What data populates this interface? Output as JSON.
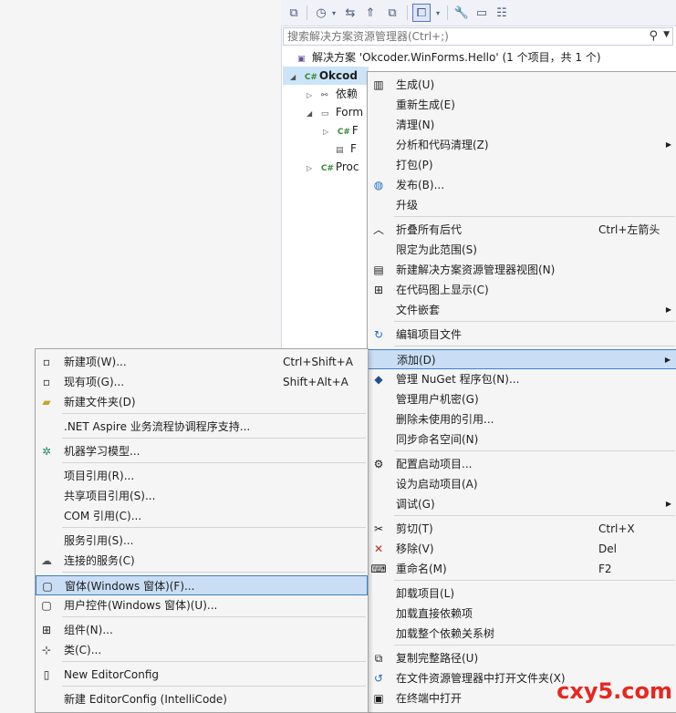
{
  "toolbar": {
    "icons": [
      "vs-icon",
      "history-icon",
      "dropdown-icon",
      "sync-icon",
      "collapse-icon",
      "copy-icon",
      "filter-icon",
      "dropdown-icon",
      "wrench-icon",
      "minus-icon",
      "class-view-icon"
    ]
  },
  "search": {
    "placeholder": "搜索解决方案资源管理器(Ctrl+;)"
  },
  "tree": {
    "solution": "解决方案 'Okcoder.WinForms.Hello' (1 个项目，共 1 个)",
    "project": "Okcod",
    "dependencies": "依赖",
    "forms": "Form",
    "form_file_1": "F",
    "form_file_2": "F",
    "program": "Proc"
  },
  "main_menu": [
    {
      "label": "生成(U)",
      "icon": "build-icon"
    },
    {
      "label": "重新生成(E)"
    },
    {
      "label": "清理(N)"
    },
    {
      "label": "分析和代码清理(Z)",
      "submenu": true
    },
    {
      "label": "打包(P)"
    },
    {
      "label": "发布(B)...",
      "icon": "globe-icon"
    },
    {
      "label": "升级"
    },
    {
      "label": "折叠所有后代",
      "shortcut": "Ctrl+左箭头",
      "icon": "chevron-up-icon"
    },
    {
      "label": "限定为此范围(S)"
    },
    {
      "label": "新建解决方案资源管理器视图(N)",
      "icon": "new-view-icon"
    },
    {
      "label": "在代码图上显示(C)",
      "icon": "code-map-icon"
    },
    {
      "label": "文件嵌套",
      "submenu": true
    },
    {
      "label": "编辑项目文件",
      "icon": "edit-icon"
    },
    {
      "label": "添加(D)",
      "submenu": true,
      "highlight": true
    },
    {
      "label": "管理 NuGet 程序包(N)...",
      "icon": "nuget-icon"
    },
    {
      "label": "管理用户机密(G)"
    },
    {
      "label": "删除未使用的引用..."
    },
    {
      "label": "同步命名空间(N)"
    },
    {
      "label": "配置启动项目...",
      "icon": "gear-icon"
    },
    {
      "label": "设为启动项目(A)"
    },
    {
      "label": "调试(G)",
      "submenu": true
    },
    {
      "label": "剪切(T)",
      "shortcut": "Ctrl+X",
      "icon": "scissors-icon"
    },
    {
      "label": "移除(V)",
      "shortcut": "Del",
      "icon": "remove-icon"
    },
    {
      "label": "重命名(M)",
      "shortcut": "F2",
      "icon": "rename-icon"
    },
    {
      "label": "卸载项目(L)"
    },
    {
      "label": "加载直接依赖项"
    },
    {
      "label": "加载整个依赖关系树"
    },
    {
      "label": "复制完整路径(U)",
      "icon": "copy-icon"
    },
    {
      "label": "在文件资源管理器中打开文件夹(X)",
      "icon": "refresh-icon"
    },
    {
      "label": "在终端中打开",
      "icon": "terminal-icon"
    }
  ],
  "sub_menu": [
    {
      "label": "新建项(W)...",
      "shortcut": "Ctrl+Shift+A",
      "icon": "new-item-icon"
    },
    {
      "label": "现有项(G)...",
      "shortcut": "Shift+Alt+A",
      "icon": "existing-item-icon"
    },
    {
      "label": "新建文件夹(D)",
      "icon": "new-folder-icon"
    },
    {
      "label": ".NET Aspire 业务流程协调程序支持..."
    },
    {
      "label": "机器学习模型...",
      "icon": "ml-icon"
    },
    {
      "label": "项目引用(R)..."
    },
    {
      "label": "共享项目引用(S)..."
    },
    {
      "label": "COM 引用(C)..."
    },
    {
      "label": "服务引用(S)..."
    },
    {
      "label": "连接的服务(C)",
      "icon": "connected-service-icon"
    },
    {
      "label": "窗体(Windows 窗体)(F)...",
      "icon": "form-icon",
      "highlight": true
    },
    {
      "label": "用户控件(Windows 窗体)(U)...",
      "icon": "user-control-icon"
    },
    {
      "label": "组件(N)...",
      "icon": "component-icon"
    },
    {
      "label": "类(C)...",
      "icon": "class-icon"
    },
    {
      "label": "New EditorConfig",
      "icon": "file-icon"
    },
    {
      "label": "新建 EditorConfig (IntelliCode)"
    }
  ],
  "watermark": "cxy5.com"
}
